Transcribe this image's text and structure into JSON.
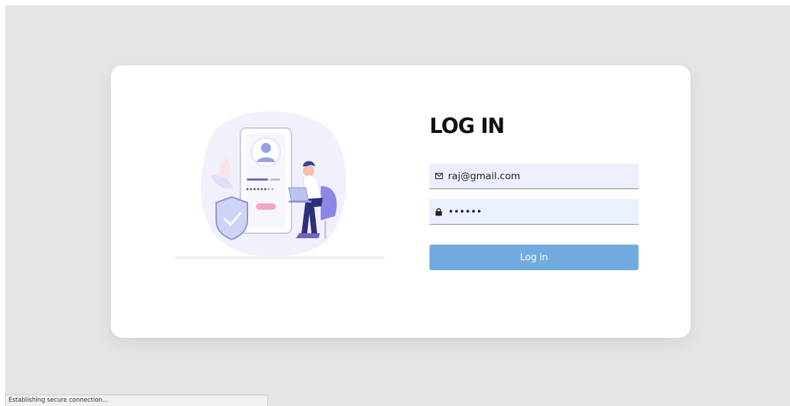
{
  "login": {
    "title": "LOG IN",
    "email_value": "raj@gmail.com",
    "password_value": "rajraj",
    "button_label": "Log in"
  },
  "status": {
    "text": "Establishing secure connection..."
  },
  "icons": {
    "email": "envelope-icon",
    "password": "lock-icon",
    "illustration": "secure-login-illustration"
  },
  "colors": {
    "background": "#e6e5e6",
    "card": "#ffffff",
    "input_bg": "#eaf0fd",
    "button": "#71aadf",
    "accent_purple": "#7b6ee0"
  }
}
